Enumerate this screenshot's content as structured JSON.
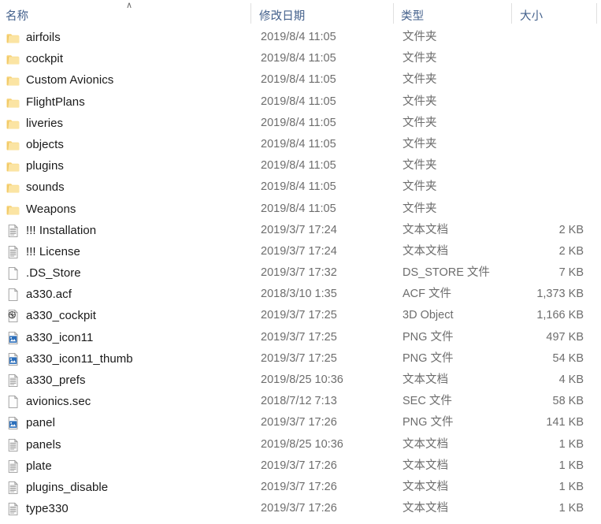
{
  "window": {
    "view": "details",
    "sort_column": "名称",
    "sort_direction": "ascending",
    "sort_glyph": "∧"
  },
  "colors": {
    "header_text": "#44618c",
    "row_name_text": "#1a1a1a",
    "row_meta_text": "#6d6d6d",
    "divider": "#e0e0e0",
    "folder_icon": "#f7d277",
    "folder_icon_dark": "#e9b949",
    "png_icon": "#2a6ebb",
    "file_outline": "#9a9a9a",
    "background": "#ffffff"
  },
  "columns": [
    {
      "key": "name",
      "label": "名称"
    },
    {
      "key": "date",
      "label": "修改日期"
    },
    {
      "key": "type",
      "label": "类型"
    },
    {
      "key": "size",
      "label": "大小"
    }
  ],
  "items": [
    {
      "name": "airfoils",
      "date": "2019/8/4 11:05",
      "type": "文件夹",
      "size": "",
      "icon": "folder-icon"
    },
    {
      "name": "cockpit",
      "date": "2019/8/4 11:05",
      "type": "文件夹",
      "size": "",
      "icon": "folder-icon"
    },
    {
      "name": "Custom Avionics",
      "date": "2019/8/4 11:05",
      "type": "文件夹",
      "size": "",
      "icon": "folder-icon"
    },
    {
      "name": "FlightPlans",
      "date": "2019/8/4 11:05",
      "type": "文件夹",
      "size": "",
      "icon": "folder-icon"
    },
    {
      "name": "liveries",
      "date": "2019/8/4 11:05",
      "type": "文件夹",
      "size": "",
      "icon": "folder-icon"
    },
    {
      "name": "objects",
      "date": "2019/8/4 11:05",
      "type": "文件夹",
      "size": "",
      "icon": "folder-icon"
    },
    {
      "name": "plugins",
      "date": "2019/8/4 11:05",
      "type": "文件夹",
      "size": "",
      "icon": "folder-icon"
    },
    {
      "name": "sounds",
      "date": "2019/8/4 11:05",
      "type": "文件夹",
      "size": "",
      "icon": "folder-icon"
    },
    {
      "name": "Weapons",
      "date": "2019/8/4 11:05",
      "type": "文件夹",
      "size": "",
      "icon": "folder-icon"
    },
    {
      "name": "!!! Installation",
      "date": "2019/3/7 17:24",
      "type": "文本文档",
      "size": "2 KB",
      "icon": "text-document-icon"
    },
    {
      "name": "!!! License",
      "date": "2019/3/7 17:24",
      "type": "文本文档",
      "size": "2 KB",
      "icon": "text-document-icon"
    },
    {
      "name": ".DS_Store",
      "date": "2019/3/7 17:32",
      "type": "DS_STORE 文件",
      "size": "7 KB",
      "icon": "blank-file-icon"
    },
    {
      "name": "a330.acf",
      "date": "2018/3/10 1:35",
      "type": "ACF 文件",
      "size": "1,373 KB",
      "icon": "blank-file-icon"
    },
    {
      "name": "a330_cockpit",
      "date": "2019/3/7 17:25",
      "type": "3D Object",
      "size": "1,166 KB",
      "icon": "3d-object-icon"
    },
    {
      "name": "a330_icon11",
      "date": "2019/3/7 17:25",
      "type": "PNG 文件",
      "size": "497 KB",
      "icon": "png-image-icon"
    },
    {
      "name": "a330_icon11_thumb",
      "date": "2019/3/7 17:25",
      "type": "PNG 文件",
      "size": "54 KB",
      "icon": "png-image-icon"
    },
    {
      "name": "a330_prefs",
      "date": "2019/8/25 10:36",
      "type": "文本文档",
      "size": "4 KB",
      "icon": "text-document-icon"
    },
    {
      "name": "avionics.sec",
      "date": "2018/7/12 7:13",
      "type": "SEC 文件",
      "size": "58 KB",
      "icon": "blank-file-icon"
    },
    {
      "name": "panel",
      "date": "2019/3/7 17:26",
      "type": "PNG 文件",
      "size": "141 KB",
      "icon": "png-image-icon"
    },
    {
      "name": "panels",
      "date": "2019/8/25 10:36",
      "type": "文本文档",
      "size": "1 KB",
      "icon": "text-document-icon"
    },
    {
      "name": "plate",
      "date": "2019/3/7 17:26",
      "type": "文本文档",
      "size": "1 KB",
      "icon": "text-document-icon"
    },
    {
      "name": "plugins_disable",
      "date": "2019/3/7 17:26",
      "type": "文本文档",
      "size": "1 KB",
      "icon": "text-document-icon"
    },
    {
      "name": "type330",
      "date": "2019/3/7 17:26",
      "type": "文本文档",
      "size": "1 KB",
      "icon": "text-document-icon"
    }
  ]
}
